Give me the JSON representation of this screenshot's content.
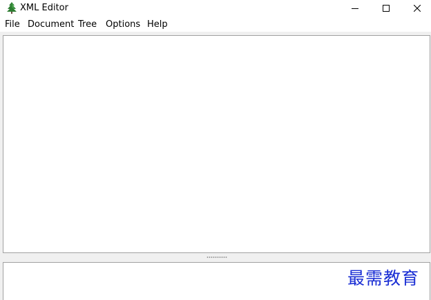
{
  "window": {
    "title": "XML Editor"
  },
  "menubar": {
    "items": [
      {
        "label": "File"
      },
      {
        "label": "Document"
      },
      {
        "label": "Tree"
      },
      {
        "label": "Options"
      },
      {
        "label": "Help"
      }
    ]
  },
  "icons": {
    "app": "tree-icon",
    "minimize": "minimize-icon",
    "maximize": "maximize-icon",
    "close": "close-icon"
  },
  "colors": {
    "window_bg": "#f0f0f0",
    "pane_bg": "#ffffff",
    "pane_border": "#a0a0a0",
    "app_icon": "#2e7d32",
    "watermark": "#1a2ed4"
  },
  "watermark": {
    "text": "最需教育"
  }
}
